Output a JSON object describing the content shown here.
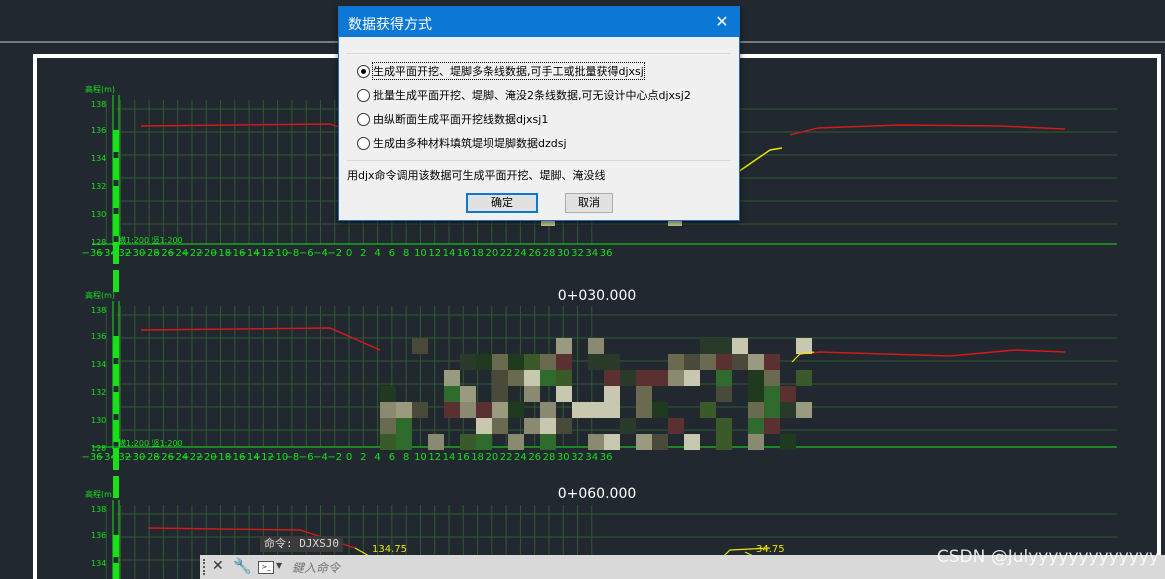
{
  "dialog": {
    "title": "数据获得方式",
    "close_glyph": "✕",
    "options": [
      {
        "label": "生成平面开挖、堤脚多条线数据,可手工或批量获得djxsj",
        "checked": true
      },
      {
        "label": "批量生成平面开挖、堤脚、淹没2条线数据,可无设计中心点djxsj2",
        "checked": false
      },
      {
        "label": "由纵断面生成平面开挖线数据djxsj1",
        "checked": false
      },
      {
        "label": "生成由多种材料填筑堤坝堤脚数据dzdsj",
        "checked": false
      }
    ],
    "hint": "用djx命令调用该数据可生成平面开挖、堤脚、淹没线",
    "ok_label": "确定",
    "cancel_label": "取消"
  },
  "drawing": {
    "sections": [
      {
        "title": "",
        "ylabel": "高程(m)",
        "scale_h": "横1:200",
        "scale_v": "竖1:200",
        "yticks": [
          "136",
          "134",
          "132",
          "130",
          "128",
          "138"
        ]
      },
      {
        "title": "0+030.000",
        "ylabel": "高程(m)",
        "scale_h": "横1:200",
        "scale_v": "竖1:200",
        "yticks": [
          "136",
          "134",
          "132",
          "130",
          "128",
          "138"
        ]
      },
      {
        "title": "0+060.000",
        "ylabel": "高程(m)",
        "annot_left": "134.75",
        "annot_right": "34.75",
        "yticks": [
          "136",
          "134",
          "138"
        ]
      }
    ],
    "xticks": [
      "−36",
      "−34",
      "−32",
      "−30",
      "−28",
      "−26",
      "−24",
      "−22",
      "−20",
      "−18",
      "−16",
      "−14",
      "−12",
      "−10",
      "−8",
      "−6",
      "−4",
      "−2",
      "0",
      "2",
      "4",
      "6",
      "8",
      "10",
      "12",
      "14",
      "16",
      "18",
      "20",
      "22",
      "24",
      "26",
      "28",
      "30",
      "32",
      "34",
      "36"
    ],
    "colors": {
      "grid": "#2f5a30",
      "axis": "#19e019",
      "ground": "#d61a1a",
      "frame": "#ffffff"
    }
  },
  "command": {
    "history": "命令: DJXSJ0",
    "placeholder": "鍵入命令",
    "close_glyph": "✕",
    "wrench_glyph": "🔧"
  },
  "watermark": "CSDN @Julyyyyyyyyyyyyy"
}
